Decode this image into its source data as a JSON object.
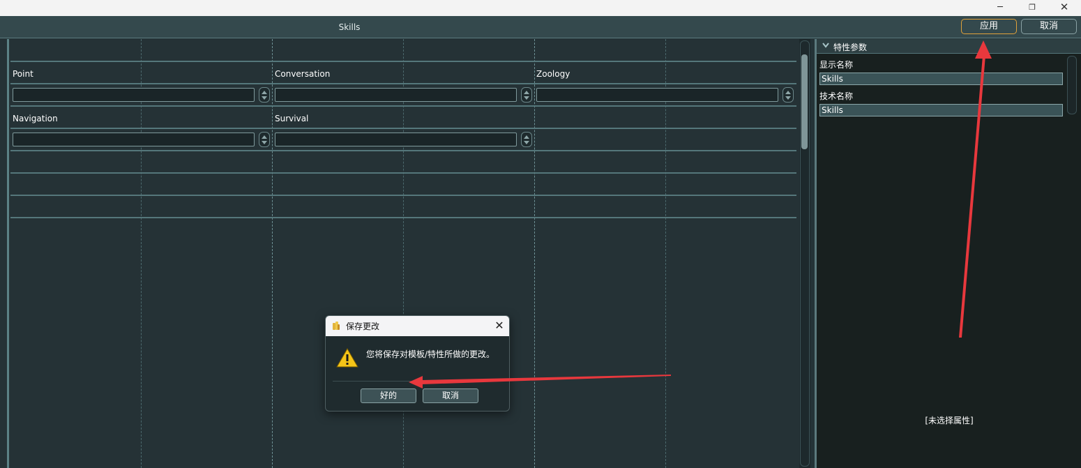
{
  "window": {
    "minimize_glyph": "─",
    "maximize_glyph": "❐",
    "close_glyph": "✕"
  },
  "header": {
    "title": "Skills",
    "apply_label": "应用",
    "cancel_label": "取消"
  },
  "fields": [
    {
      "label": "Point",
      "value": ""
    },
    {
      "label": "Conversation",
      "value": ""
    },
    {
      "label": "Zoology",
      "value": ""
    },
    {
      "label": "Navigation",
      "value": ""
    },
    {
      "label": "Survival",
      "value": ""
    }
  ],
  "properties": {
    "title": "特性参数",
    "display_name_label": "显示名称",
    "display_name_value": "Skills",
    "tech_name_label": "技术名称",
    "tech_name_value": "Skills",
    "empty_note": "[未选择属性]"
  },
  "dialog": {
    "title": "保存更改",
    "message": "您将保存对模板/特性所做的更改。",
    "ok_label": "好的",
    "cancel_label": "取消",
    "close_glyph": "✕"
  },
  "colors": {
    "apply_border": "#e0a23a",
    "annotation_arrow": "#e8383d",
    "panel_background": "#18201f",
    "canvas_background": "#253236"
  }
}
